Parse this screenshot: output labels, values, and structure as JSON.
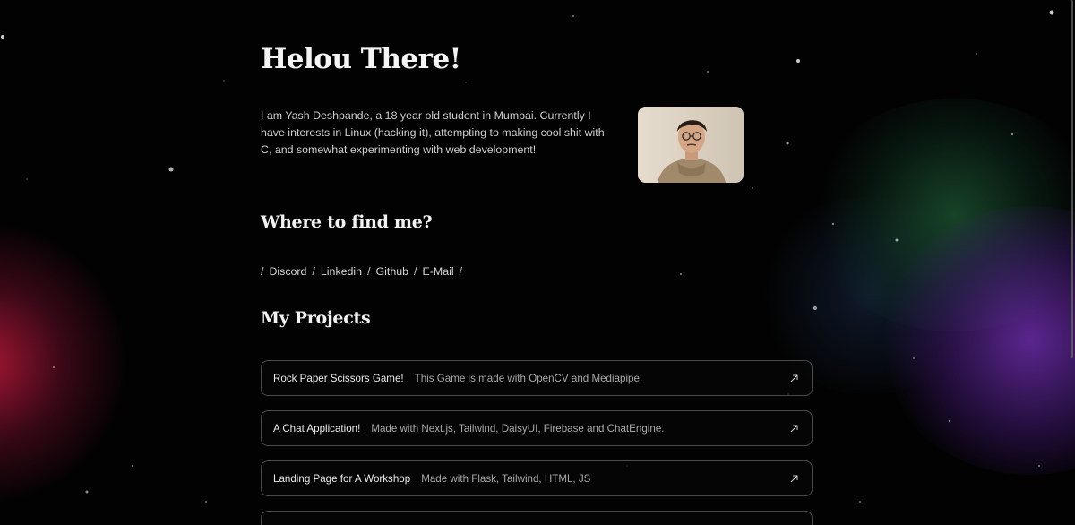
{
  "hero": {
    "title": "Helou There!",
    "intro": "I am Yash Deshpande, a 18 year old student in Mumbai. Currently I have interests in Linux (hacking it), attempting to making cool shit with C, and somewhat experimenting with web development!"
  },
  "find_me": {
    "title": "Where to find me?",
    "separator": "/",
    "links": [
      {
        "label": "Discord"
      },
      {
        "label": "Linkedin"
      },
      {
        "label": "Github"
      },
      {
        "label": "E-Mail"
      }
    ]
  },
  "projects": {
    "title": "My Projects",
    "items": [
      {
        "name": "Rock Paper Scissors Game!",
        "description": "This Game is made with OpenCV and Mediapipe.",
        "icon": "external-arrow-icon"
      },
      {
        "name": "A Chat Application!",
        "description": "Made with Next.js, Tailwind, DaisyUI, Firebase and ChatEngine.",
        "icon": "external-arrow-icon"
      },
      {
        "name": "Landing Page for A Workshop",
        "description": "Made with Flask, Tailwind, HTML, JS",
        "icon": "external-arrow-icon"
      },
      {
        "name": "",
        "description": "",
        "icon": "external-arrow-icon"
      }
    ]
  },
  "colors": {
    "background": "#020202",
    "accent_red": "#be193c",
    "accent_green": "#287846",
    "accent_purple": "#7832be",
    "card_border": "#4a4a4a"
  }
}
